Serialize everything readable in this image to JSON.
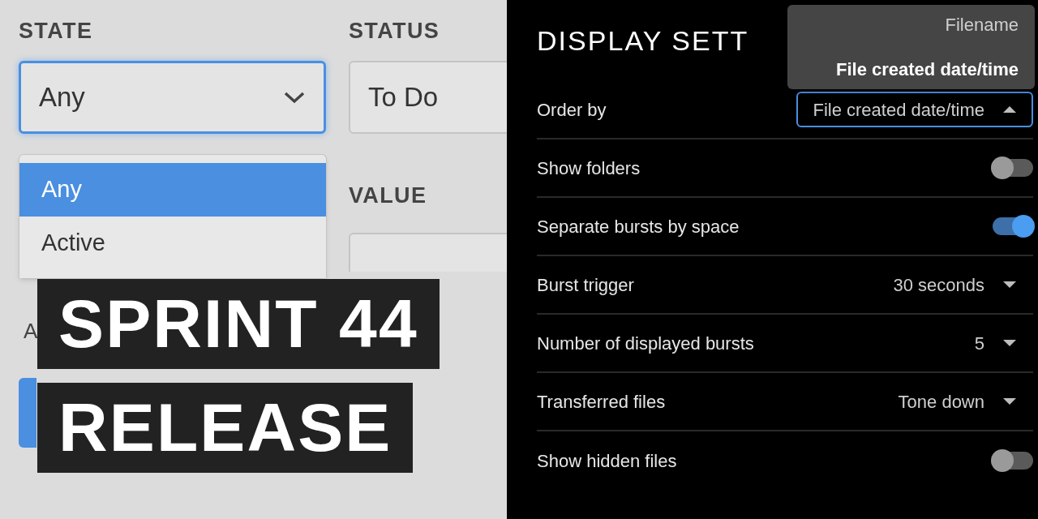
{
  "form": {
    "fields": [
      {
        "label": "STATE",
        "value": "Any",
        "focused": true
      },
      {
        "label": "STATUS",
        "value": "To Do",
        "focused": false
      }
    ],
    "state_options": [
      {
        "label": "Any",
        "selected": true
      },
      {
        "label": "Active",
        "selected": false
      }
    ],
    "value_field": {
      "label": "VALUE"
    },
    "cut_label": "A"
  },
  "banner": [
    "SPRINT 44",
    "RELEASE"
  ],
  "settings": {
    "title": "DISPLAY SETT",
    "menu": [
      {
        "label": "Filename",
        "selected": false
      },
      {
        "label": "File created date/time",
        "selected": true
      }
    ],
    "rows": [
      {
        "kind": "dropdown",
        "label": "Order by",
        "value": "File created date/time",
        "open": true
      },
      {
        "kind": "toggle",
        "label": "Show folders",
        "on": false
      },
      {
        "kind": "toggle",
        "label": "Separate bursts by space",
        "on": true
      },
      {
        "kind": "dropdown",
        "label": "Burst trigger",
        "value": "30 seconds",
        "open": false
      },
      {
        "kind": "dropdown",
        "label": "Number of displayed bursts",
        "value": "5",
        "open": false
      },
      {
        "kind": "dropdown",
        "label": "Transferred files",
        "value": "Tone down",
        "open": false
      },
      {
        "kind": "toggle",
        "label": "Show hidden files",
        "on": false
      }
    ]
  }
}
